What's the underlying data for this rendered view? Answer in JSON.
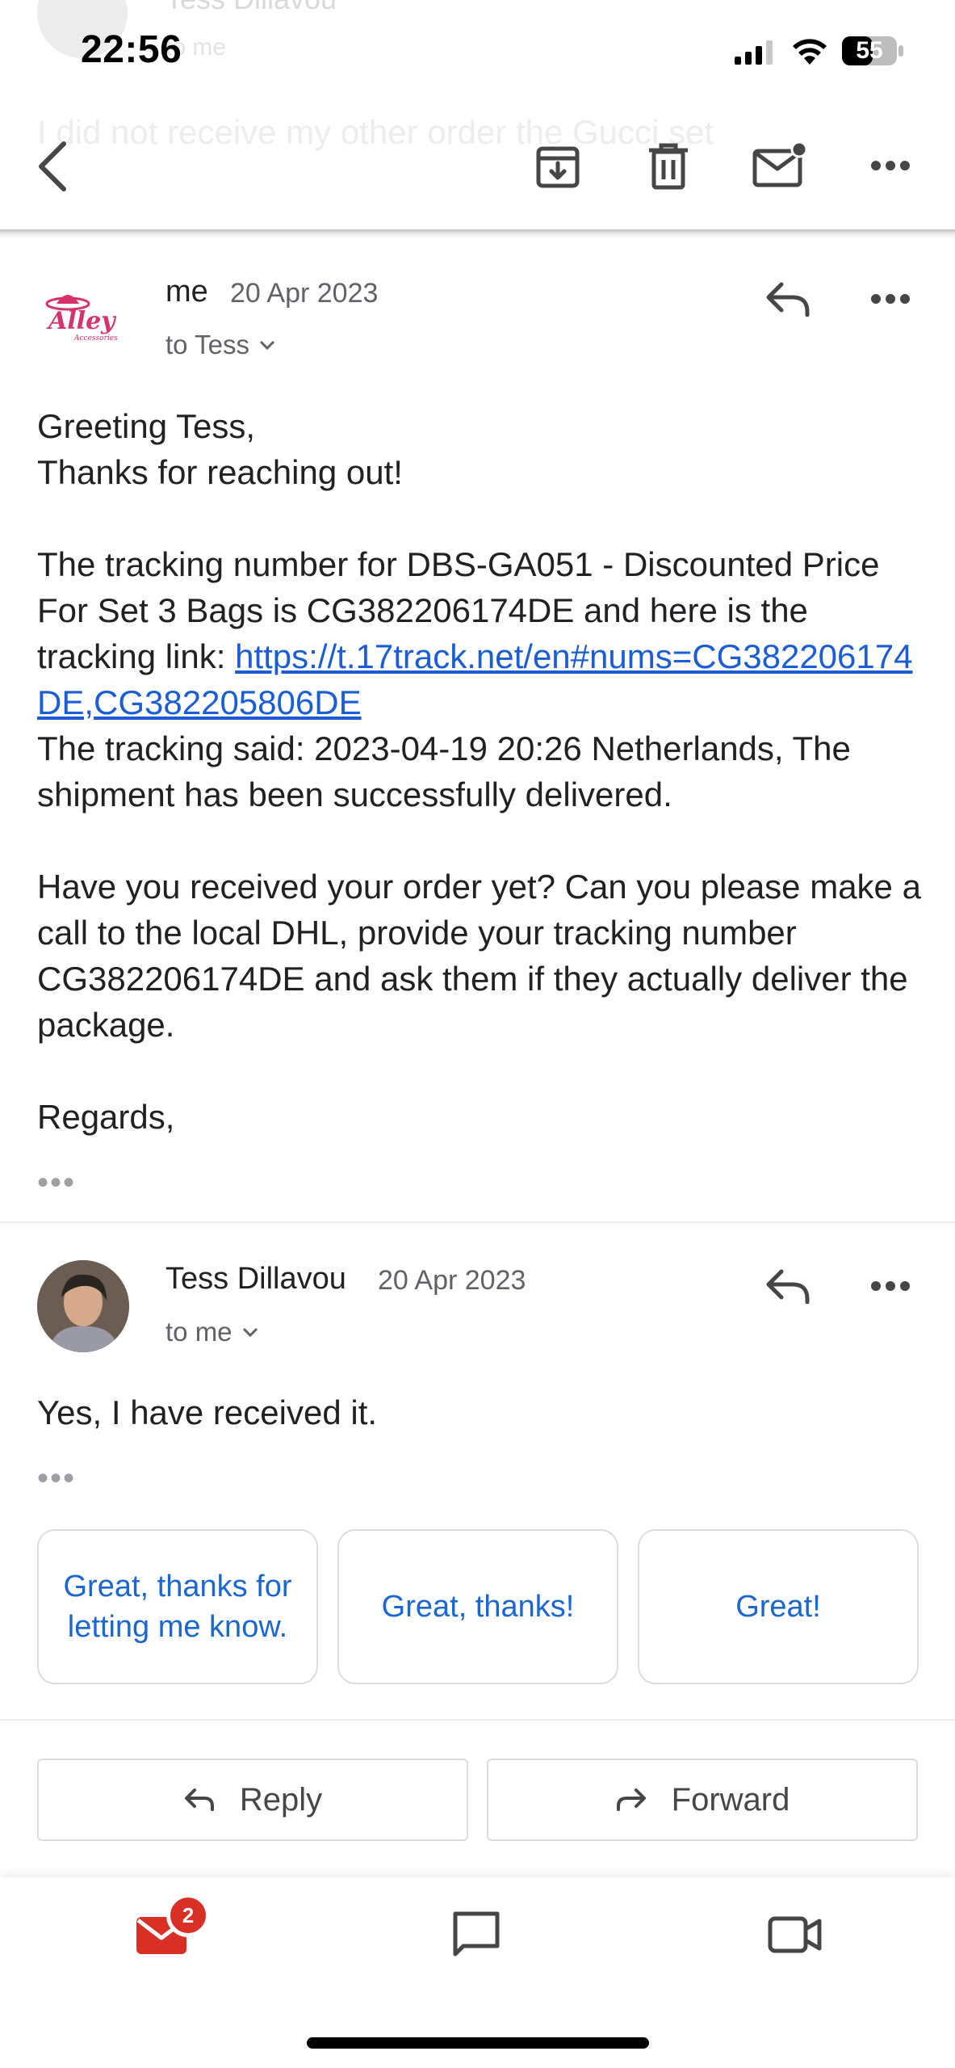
{
  "status_bar": {
    "time": "22:56",
    "battery": "55"
  },
  "background_ghost": {
    "sender": "Tess Dillavou",
    "to": "to me",
    "body": "I did not receive my other order the Gucci set"
  },
  "toolbar": {
    "back_icon": "chevron-left-icon",
    "archive_icon": "archive-icon",
    "delete_icon": "trash-icon",
    "unread_icon": "mark-unread-icon",
    "more_icon": "more-horizontal-icon"
  },
  "message1": {
    "sender": "me",
    "date": "20 Apr 2023",
    "to": "to Tess",
    "avatar_text": "Alley",
    "avatar_subtext": "Accessories",
    "greeting": "Greeting Tess,",
    "thanks": "Thanks for reaching out!",
    "para1_text": "The tracking number for DBS-GA051 - Discounted Price For Set 3 Bags is CG382206174DE and here is the tracking link: ",
    "link": "https://t.17track.net/en#nums=CG382206174DE,CG382205806DE",
    "para1_after": "The tracking said: 2023-04-19 20:26 Netherlands, The shipment has been successfully delivered.",
    "para2": "Have you received your order yet? Can you please make a call to the local DHL, provide your tracking number CG382206174DE and ask them if they actually deliver the package.",
    "closing": "Regards,",
    "trimmed": "•••"
  },
  "message2": {
    "sender": "Tess Dillavou",
    "date": "20 Apr 2023",
    "to": "to me",
    "body": "Yes, I have received it.",
    "trimmed": "•••"
  },
  "smart_replies": [
    "Great, thanks for letting me know.",
    "Great, thanks!",
    "Great!"
  ],
  "actions": {
    "reply": "Reply",
    "forward": "Forward"
  },
  "bottom_nav": {
    "mail_badge": "2"
  },
  "colors": {
    "accent": "#1a67d2",
    "link": "#1a5dd6",
    "badge": "#d93025",
    "mail_icon": "#d93025"
  }
}
